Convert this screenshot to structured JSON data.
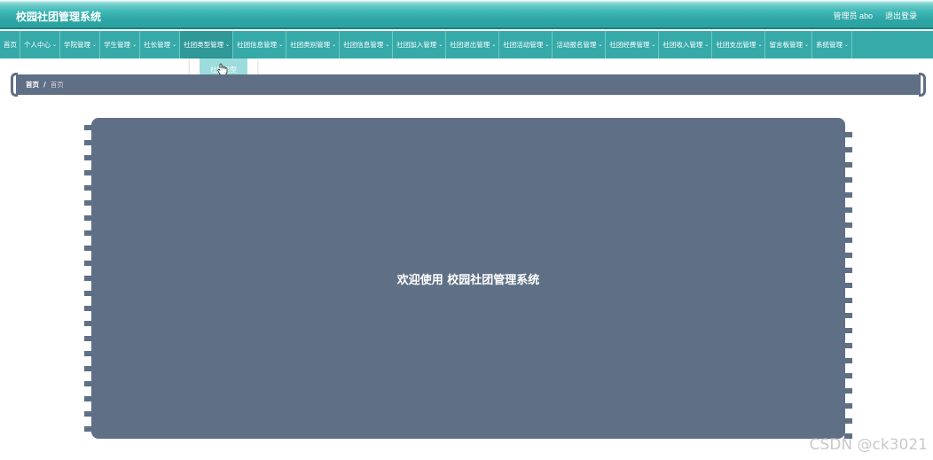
{
  "header": {
    "title": "校园社团管理系统",
    "user_label": "管理员 abo",
    "logout_label": "退出登录"
  },
  "nav": {
    "items": [
      {
        "label": "首页",
        "has_menu": false
      },
      {
        "label": "个人中心",
        "has_menu": true
      },
      {
        "label": "学院管理",
        "has_menu": true
      },
      {
        "label": "学生管理",
        "has_menu": true
      },
      {
        "label": "社长管理",
        "has_menu": true
      },
      {
        "label": "社团类型管理",
        "has_menu": true
      },
      {
        "label": "社团信息管理",
        "has_menu": true
      },
      {
        "label": "社团类别管理",
        "has_menu": true
      },
      {
        "label": "社团信息管理",
        "has_menu": true
      },
      {
        "label": "社团加入管理",
        "has_menu": true
      },
      {
        "label": "社团退出管理",
        "has_menu": true
      },
      {
        "label": "社团活动管理",
        "has_menu": true
      },
      {
        "label": "活动报名管理",
        "has_menu": true
      },
      {
        "label": "社团经费管理",
        "has_menu": true
      },
      {
        "label": "社团收入管理",
        "has_menu": true
      },
      {
        "label": "社团支出管理",
        "has_menu": true
      },
      {
        "label": "留言板管理",
        "has_menu": true
      },
      {
        "label": "系统管理",
        "has_menu": true
      }
    ],
    "open_index": 5,
    "dropdown_item": "社团类型"
  },
  "breadcrumb": {
    "home": "首页",
    "separator": "/",
    "current": "首页"
  },
  "main": {
    "welcome": "欢迎使用 校园社团管理系统"
  },
  "watermark": "CSDN @ck3021",
  "colors": {
    "header": "#2ea6a5",
    "nav": "#36aaa9",
    "panel": "#5f6f85"
  }
}
